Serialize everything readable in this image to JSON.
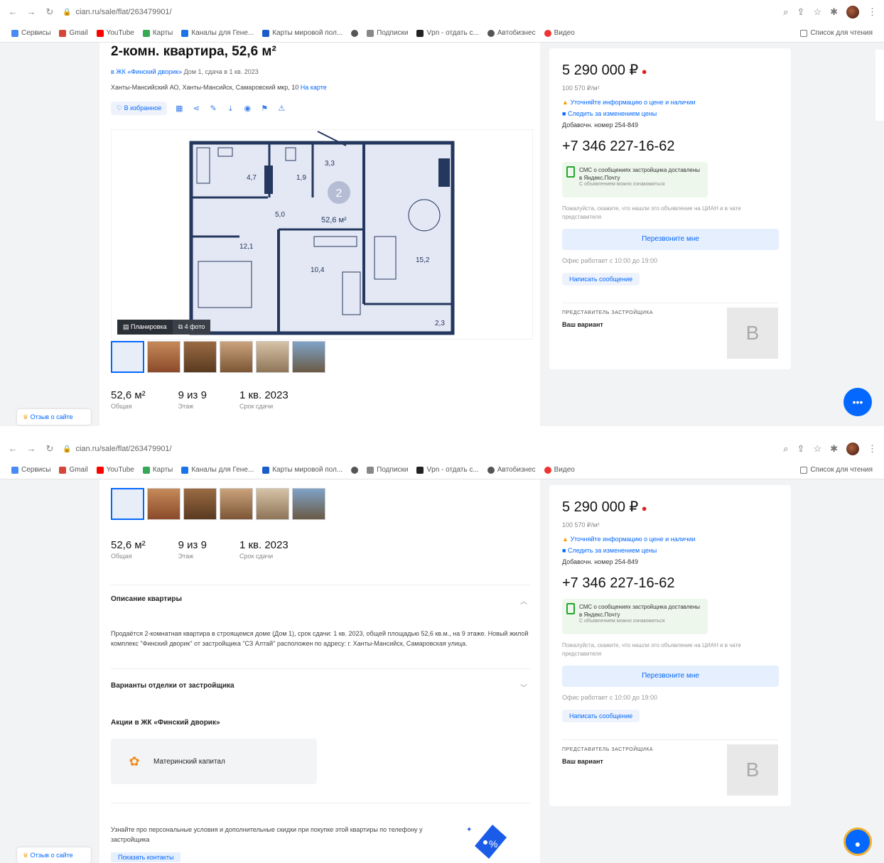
{
  "browser": {
    "url": "cian.ru/sale/flat/263479901/",
    "bookmarks": [
      "Сервисы",
      "Gmail",
      "YouTube",
      "Карты",
      "Каналы для Гене...",
      "Карты мировой пол...",
      "",
      "Подписки",
      "Vpn - отдать с...",
      "Автобизнес",
      "Видео"
    ],
    "bookmarks_right": "Список для чтения"
  },
  "listing": {
    "title": "2-комн. квартира, 52,6 м²",
    "complex_link": "в ЖК «Финский дворик»",
    "complex_meta": "Дом 1, сдача в 1 кв. 2023",
    "address": "Ханты-Мансийский АО, Ханты-Мансийск, Самаровский мкр, 10",
    "map_link": "На карте",
    "favorite_label": "В избранное",
    "plan_tag": "Планировка",
    "photo_tag": "4 фото",
    "stats": [
      {
        "value": "52,6 м²",
        "label": "Общая"
      },
      {
        "value": "9 из 9",
        "label": "Этаж"
      },
      {
        "value": "1 кв. 2023",
        "label": "Срок сдачи"
      }
    ],
    "plan_rooms": [
      "4,7",
      "1,9",
      "3,3",
      "5,0",
      "52,6 м²",
      "12,1",
      "10,4",
      "15,2",
      "2,3"
    ],
    "plan_badge": "2"
  },
  "sidebar": {
    "price": "5 290 000 ₽",
    "price_per_m": "100 570 ₽/м²",
    "warning": "Уточняйте информацию о цене и наличии",
    "note": "Следить за изменением цены",
    "code": "Добавочн. номер 254-849",
    "phone": "+7 346 227-16-62",
    "sms_title": "СМС о сообщениях застройщика доставлены в Яндекс.Почту",
    "sms_sub": "С объявлением можно ознакомиться",
    "disclaimer": "Пожалуйста, скажите, что нашли это объявление на ЦИАН и в чате представителя",
    "call_button": "Перезвоните мне",
    "hours": "Офис работает с 10:00 до 19:00",
    "message_button": "Написать сообщение",
    "developer_label": "ПРЕДСТАВИТЕЛЬ ЗАСТРОЙЩИКА",
    "developer_name": "Ваш вариант",
    "developer_logo": "B"
  },
  "details": {
    "description_title": "Описание квартиры",
    "description_text": "Продаётся 2-комнатная квартира в строящемся доме (Дом 1), срок сдачи: 1 кв. 2023, общей площадью 52,6 кв.м., на 9 этаже. Новый жилой комплекс \"Финский дворик\" от застройщика \"СЗ Алтай\" расположен по адресу: г. Ханты-Мансийск, Самаровская улица.",
    "finish_title": "Варианты отделки от застройщика",
    "promo_title": "Акции в ЖК «Финский дворик»",
    "promo_item": "Материнский капитал",
    "promo_text": "Узнайте про персональные условия и дополнительные скидки при покупке этой квартиры по телефону у застройщика",
    "promo_link": "Показать контакты"
  },
  "feedback": "Отзыв о сайте",
  "colors": {
    "accent": "#0468ff",
    "plan_wall": "#24375e",
    "plan_fill": "#e4e8f4"
  }
}
